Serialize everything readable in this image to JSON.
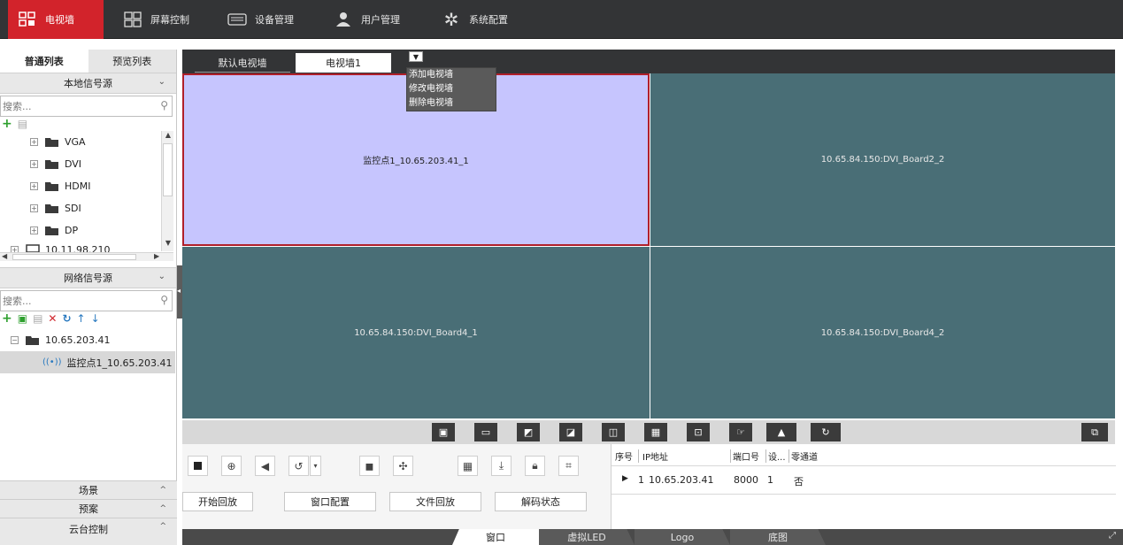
{
  "topnav": {
    "items": [
      {
        "label": "电视墙",
        "icon": "video-wall-icon"
      },
      {
        "label": "屏幕控制",
        "icon": "screen-control-icon"
      },
      {
        "label": "设备管理",
        "icon": "device-icon"
      },
      {
        "label": "用户管理",
        "icon": "user-icon"
      },
      {
        "label": "系统配置",
        "icon": "gear-icon"
      }
    ],
    "active_color": "#d2232b"
  },
  "left": {
    "tabs": [
      "普通列表",
      "预览列表"
    ],
    "local_source": {
      "title": "本地信号源",
      "search_placeholder": "搜索...",
      "items": [
        "VGA",
        "DVI",
        "HDMI",
        "SDI",
        "DP"
      ],
      "device": "10.11.98.210"
    },
    "network_source": {
      "title": "网络信号源",
      "search_placeholder": "搜索...",
      "group": "10.65.203.41",
      "channel": "监控点1_10.65.203.41"
    },
    "footer": [
      "场景",
      "预案",
      "云台控制"
    ]
  },
  "wall_tabs": {
    "tabs": [
      "默认电视墙",
      "电视墙1"
    ],
    "menu": [
      "添加电视墙",
      "修改电视墙",
      "删除电视墙"
    ]
  },
  "wall": {
    "cells": [
      "监控点1_10.65.203.41_1",
      "10.65.84.150:DVI_Board2_2",
      "10.65.84.150:DVI_Board4_1",
      "10.65.84.150:DVI_Board4_2"
    ],
    "cell_color": "#496e76",
    "selected_color": "#c6c5fe"
  },
  "controls": {
    "actions": [
      "开始回放",
      "窗口配置",
      "文件回放",
      "解码状态"
    ]
  },
  "info_table": {
    "headers": [
      "序号",
      "IP地址",
      "端口号",
      "设...",
      "零通道"
    ],
    "row": {
      "index": "1",
      "ip": "10.65.203.41",
      "port": "8000",
      "num": "1",
      "zero": "否"
    }
  },
  "bottom_tabs": [
    "窗口",
    "虚拟LED",
    "Logo",
    "底图"
  ]
}
